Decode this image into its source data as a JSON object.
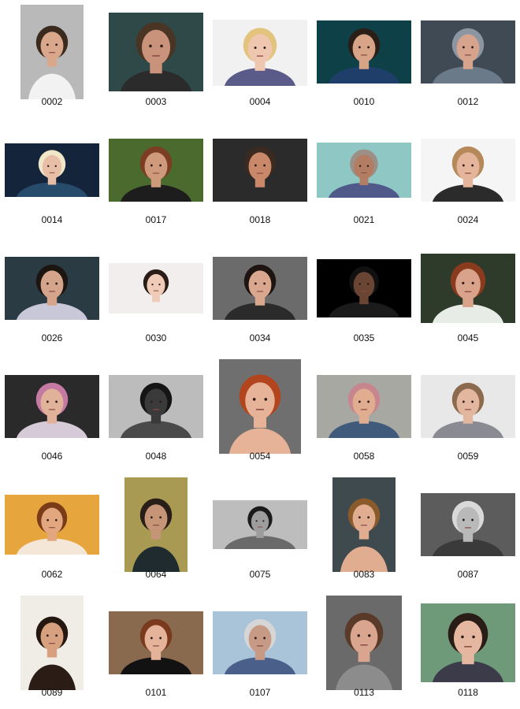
{
  "gallery": {
    "items": [
      {
        "id": "0002",
        "description": "smiling man with glasses, white t-shirt",
        "bg": "#b9b9b9",
        "skin": "#d9a88c",
        "hair": "#3b2a1e",
        "cloth": "#f2f2f2"
      },
      {
        "id": "0003",
        "description": "man with styled hair, dark background",
        "bg": "#2f4848",
        "skin": "#c9927a",
        "hair": "#4a3525",
        "cloth": "#2b2b2b"
      },
      {
        "id": "0004",
        "description": "blonde woman in plaid shirt",
        "bg": "#f1f1f1",
        "skin": "#efc7b0",
        "hair": "#e3c47e",
        "cloth": "#5b5b8a"
      },
      {
        "id": "0010",
        "description": "man in blue suit",
        "bg": "#0e4047",
        "skin": "#d8a487",
        "hair": "#2b1e16",
        "cloth": "#1f3e6a"
      },
      {
        "id": "0012",
        "description": "bearded man with beanie",
        "bg": "#3f4a55",
        "skin": "#d6a48d",
        "hair": "#8c96a2",
        "cloth": "#6a7a88"
      },
      {
        "id": "0014",
        "description": "smiling blonde woman, dark background",
        "bg": "#14243b",
        "skin": "#e8bfa6",
        "hair": "#f0e6c8",
        "cloth": "#274b6a"
      },
      {
        "id": "0017",
        "description": "bearded man in garden",
        "bg": "#4b6a2e",
        "skin": "#cf9a7c",
        "hair": "#7b3e24",
        "cloth": "#1d1d1d"
      },
      {
        "id": "0018",
        "description": "close-up woman face",
        "bg": "#2b2b2b",
        "skin": "#c9886a",
        "hair": "#3a2a20",
        "cloth": "#2b2b2b"
      },
      {
        "id": "0021",
        "description": "elderly man outdoors",
        "bg": "#8fc7c4",
        "skin": "#b27d62",
        "hair": "#9b8f86",
        "cloth": "#4f5a8a"
      },
      {
        "id": "0024",
        "description": "woman with long hair, white background",
        "bg": "#f5f5f5",
        "skin": "#e4b59b",
        "hair": "#b5895a",
        "cloth": "#2b2b2b"
      },
      {
        "id": "0026",
        "description": "woman in patterned top",
        "bg": "#2a3b44",
        "skin": "#d5a58b",
        "hair": "#1c1512",
        "cloth": "#c8c8d8"
      },
      {
        "id": "0030",
        "description": "woman with short dark hair, profile",
        "bg": "#f2eeee",
        "skin": "#efcbb8",
        "hair": "#2a1d18",
        "cloth": "#f2eeee"
      },
      {
        "id": "0034",
        "description": "woman with glasses",
        "bg": "#6b6b6b",
        "skin": "#d9a78e",
        "hair": "#1e1512",
        "cloth": "#2b2b2b"
      },
      {
        "id": "0035",
        "description": "man in black jacket, dark background",
        "bg": "#000000",
        "skin": "#6a4534",
        "hair": "#111111",
        "cloth": "#1b1b1b"
      },
      {
        "id": "0045",
        "description": "woman behind white flowers",
        "bg": "#2e3a2a",
        "skin": "#d9a38b",
        "hair": "#8a3b1e",
        "cloth": "#e8ece6"
      },
      {
        "id": "0046",
        "description": "woman in pink hijab",
        "bg": "#2a2a2a",
        "skin": "#e0b29a",
        "hair": "#c47aa2",
        "cloth": "#d6c9d8"
      },
      {
        "id": "0048",
        "description": "black and white portrait of boy",
        "bg": "#bcbcbc",
        "skin": "#3a3a3a",
        "hair": "#151515",
        "cloth": "#4a4a4a"
      },
      {
        "id": "0054",
        "description": "woman with red hair",
        "bg": "#6f6f6f",
        "skin": "#e7b398",
        "hair": "#b2451e",
        "cloth": "#e7b398"
      },
      {
        "id": "0058",
        "description": "woman with pink hair, outdoors",
        "bg": "#a8a8a2",
        "skin": "#e0ad91",
        "hair": "#c7858e",
        "cloth": "#3f5a7a"
      },
      {
        "id": "0059",
        "description": "woman looking up, grey background",
        "bg": "#e8e8e8",
        "skin": "#e3b6a0",
        "hair": "#8b6a4d",
        "cloth": "#8a8a92"
      },
      {
        "id": "0062",
        "description": "woman in warm sunlight",
        "bg": "#e7a63d",
        "skin": "#e2a77e",
        "hair": "#7a3b18",
        "cloth": "#f5e7d8"
      },
      {
        "id": "0064",
        "description": "man with short hair",
        "bg": "#a89a52",
        "skin": "#c69578",
        "hair": "#2a1f18",
        "cloth": "#1f2b2e"
      },
      {
        "id": "0075",
        "description": "black and white girl portrait",
        "bg": "#bdbdbd",
        "skin": "#9d9d9d",
        "hair": "#1b1b1b",
        "cloth": "#6a6a6a"
      },
      {
        "id": "0083",
        "description": "woman with freckles and curly hair",
        "bg": "#3f4a4e",
        "skin": "#e0ad91",
        "hair": "#8b5a2b",
        "cloth": "#e0ad91"
      },
      {
        "id": "0087",
        "description": "laughing elderly man, black and white",
        "bg": "#5c5c5c",
        "skin": "#b9b9b9",
        "hair": "#d9d9d9",
        "cloth": "#3a3a3a"
      },
      {
        "id": "0089",
        "description": "woman with long dark hair, sunlight",
        "bg": "#f0ece6",
        "skin": "#d7a07e",
        "hair": "#241810",
        "cloth": "#2b1d16"
      },
      {
        "id": "0101",
        "description": "woman with short red hair, top-down",
        "bg": "#8a6a4f",
        "skin": "#e4b39a",
        "hair": "#7a3a1e",
        "cloth": "#121212"
      },
      {
        "id": "0107",
        "description": "elderly man near bridge",
        "bg": "#a9c3d8",
        "skin": "#c69a84",
        "hair": "#d6d6d6",
        "cloth": "#4a5f8a"
      },
      {
        "id": "0113",
        "description": "woman on street",
        "bg": "#6a6a6a",
        "skin": "#d9a58f",
        "hair": "#5a3b2a",
        "cloth": "#8c8c8c"
      },
      {
        "id": "0118",
        "description": "woman with red lips, green background",
        "bg": "#6f9a7a",
        "skin": "#e5b7a0",
        "hair": "#2a1c16",
        "cloth": "#3b3b4a"
      }
    ]
  }
}
